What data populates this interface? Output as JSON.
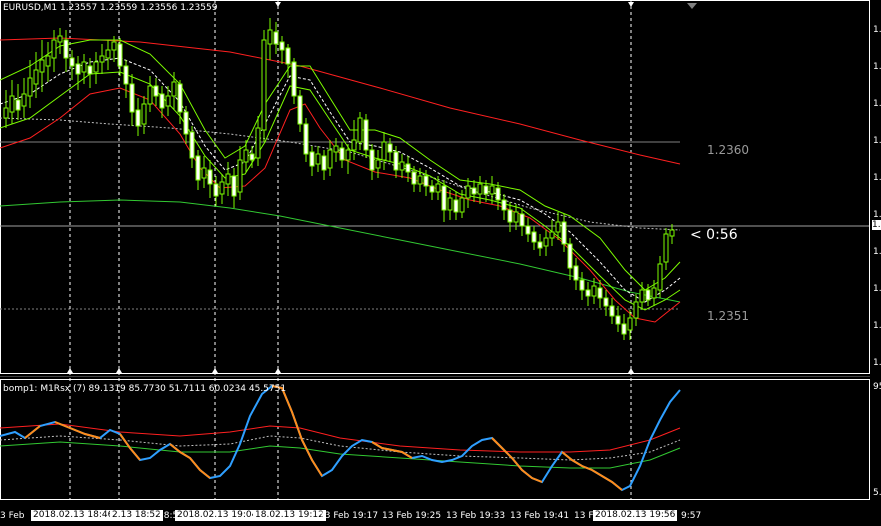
{
  "chart_header": "EURUSD,M1  1.23557 1.23559 1.23556 1.23559",
  "indicator_header": "bomp1: M1Rsx (7) 89.1319 85.7730 51.7111 60.0234 45.5751",
  "countdown": "< 0:56",
  "level_labels": [
    "1.2360",
    "1.2351"
  ],
  "price_axis_labels": [
    "1.",
    "1.",
    "1.",
    "1.",
    "1.",
    "1.",
    "1.",
    "1.",
    "1.",
    "1.",
    "1."
  ],
  "indicator_axis": {
    "top": "95",
    "bottom": "5."
  },
  "time_axis": {
    "left_partial": "3 Feb",
    "right_partial": "9:57",
    "labels": [
      "13 Feb 19:17",
      "13 Feb 19:25",
      "13 Feb 19:33",
      "13 Feb 19:41",
      "13 F"
    ],
    "crosshair_labels": [
      "2018.02.13 18:46",
      "2.13 18:52",
      "2018.02.13 19:04",
      "18.02.13 19:12",
      "2018.02.13 19:56"
    ],
    "fragment": "18:5"
  },
  "colors": {
    "background": "#000000",
    "bull_candle": "#7CFC00",
    "bear_candle": "#ffffff",
    "ma_red": "#ff2020",
    "ma_green": "#32c832",
    "band_green": "#7CFC00",
    "rsx_blue": "#2f9fff",
    "rsx_orange": "#ff8c1a"
  }
}
